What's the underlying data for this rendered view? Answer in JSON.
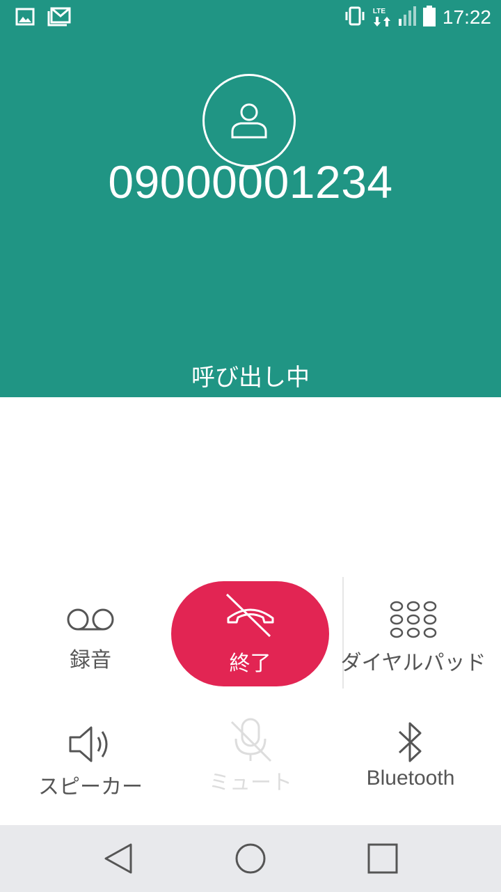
{
  "status_bar": {
    "time": "17:22",
    "network_label": "LTE",
    "icons": [
      "image-notification-icon",
      "gmail-icon",
      "vibrate-icon",
      "lte-icon",
      "signal-icon",
      "battery-icon"
    ]
  },
  "call": {
    "number": "09000001234",
    "status": "呼び出し中"
  },
  "controls": {
    "record": {
      "label": "録音",
      "icon": "voicemail-icon"
    },
    "end_call": {
      "label": "終了",
      "icon": "end-call-icon"
    },
    "dialpad": {
      "label": "ダイヤルパッド",
      "icon": "dialpad-icon"
    },
    "speaker": {
      "label": "スピーカー",
      "icon": "speaker-icon"
    },
    "mute": {
      "label": "ミュート",
      "icon": "mute-icon",
      "enabled": false
    },
    "bluetooth": {
      "label": "Bluetooth",
      "icon": "bluetooth-icon"
    }
  },
  "navigation": [
    "back-icon",
    "home-icon",
    "recents-icon"
  ],
  "colors": {
    "header": "#209584",
    "end_call": "#e22553",
    "nav_bar": "#e8e9ec",
    "control_text": "#555555",
    "disabled": "#dddddd"
  }
}
